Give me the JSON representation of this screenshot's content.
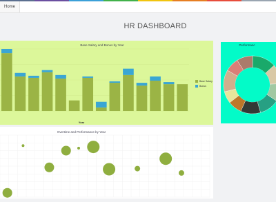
{
  "nav": {
    "home_label": "Home"
  },
  "accent_colors": [
    "#5b6f8f",
    "#6a4fa0",
    "#3ba0d8",
    "#41b14a",
    "#f1c40f",
    "#e67e22",
    "#e74c3c",
    "#9aa5b1"
  ],
  "page": {
    "title": "HR DASHBOARD"
  },
  "bar_panel": {
    "background": "#dcf79a"
  },
  "pie_panel": {
    "background": "#03fbc8",
    "title": "Performanc"
  },
  "scatter_panel": {
    "background": "#ffffff"
  },
  "chart_data": [
    {
      "type": "bar",
      "title": "Base Salary and Bonus by Year",
      "xlabel": "Year",
      "ylabel": "",
      "categories": [
        "",
        "",
        "",
        "",
        "",
        "",
        "",
        "",
        "",
        "",
        "",
        "",
        "",
        ""
      ],
      "series": [
        {
          "name": "Base Salary",
          "color": "#9bb445",
          "values": [
            82,
            49,
            47,
            55,
            46,
            15,
            47,
            5,
            40,
            51,
            36,
            43,
            38,
            38
          ]
        },
        {
          "name": "Bonus",
          "color": "#3aa6d4",
          "values": [
            6,
            5,
            3,
            3,
            5,
            0,
            2,
            8,
            2,
            9,
            4,
            6,
            3,
            0
          ]
        }
      ],
      "ylim": [
        0,
        88
      ],
      "legend": "right"
    },
    {
      "type": "pie",
      "title": "Performanc",
      "slices": [
        {
          "value": 12,
          "color": "#1aa96a"
        },
        {
          "value": 10,
          "color": "#d9c8a5"
        },
        {
          "value": 9,
          "color": "#a1c8a2"
        },
        {
          "value": 10,
          "color": "#27a083"
        },
        {
          "value": 10,
          "color": "#333a36"
        },
        {
          "value": 7,
          "color": "#bd772a"
        },
        {
          "value": 6,
          "color": "#e8e59b"
        },
        {
          "value": 11,
          "color": "#d1ae8d"
        },
        {
          "value": 7,
          "color": "#d97f77"
        },
        {
          "value": 8,
          "color": "#ab7b6b"
        }
      ],
      "inner_color": "#03fbc8"
    },
    {
      "type": "scatter",
      "title": "Overtime and Performance by Year",
      "color": "#8fae3f",
      "xlim": [
        0,
        20
      ],
      "ylim": [
        0,
        10
      ],
      "points": [
        {
          "x": 2.2,
          "y": 8.3,
          "size": 2
        },
        {
          "x": 6.3,
          "y": 7.5,
          "size": 7
        },
        {
          "x": 7.5,
          "y": 7.9,
          "size": 2
        },
        {
          "x": 8.9,
          "y": 8.1,
          "size": 9
        },
        {
          "x": 15.8,
          "y": 6.2,
          "size": 9
        },
        {
          "x": 4.7,
          "y": 4.8,
          "size": 7
        },
        {
          "x": 10.4,
          "y": 4.5,
          "size": 9
        },
        {
          "x": 13.1,
          "y": 4.6,
          "size": 4
        },
        {
          "x": 17.3,
          "y": 3.9,
          "size": 4
        },
        {
          "x": 0.7,
          "y": 0.7,
          "size": 7
        }
      ]
    }
  ]
}
